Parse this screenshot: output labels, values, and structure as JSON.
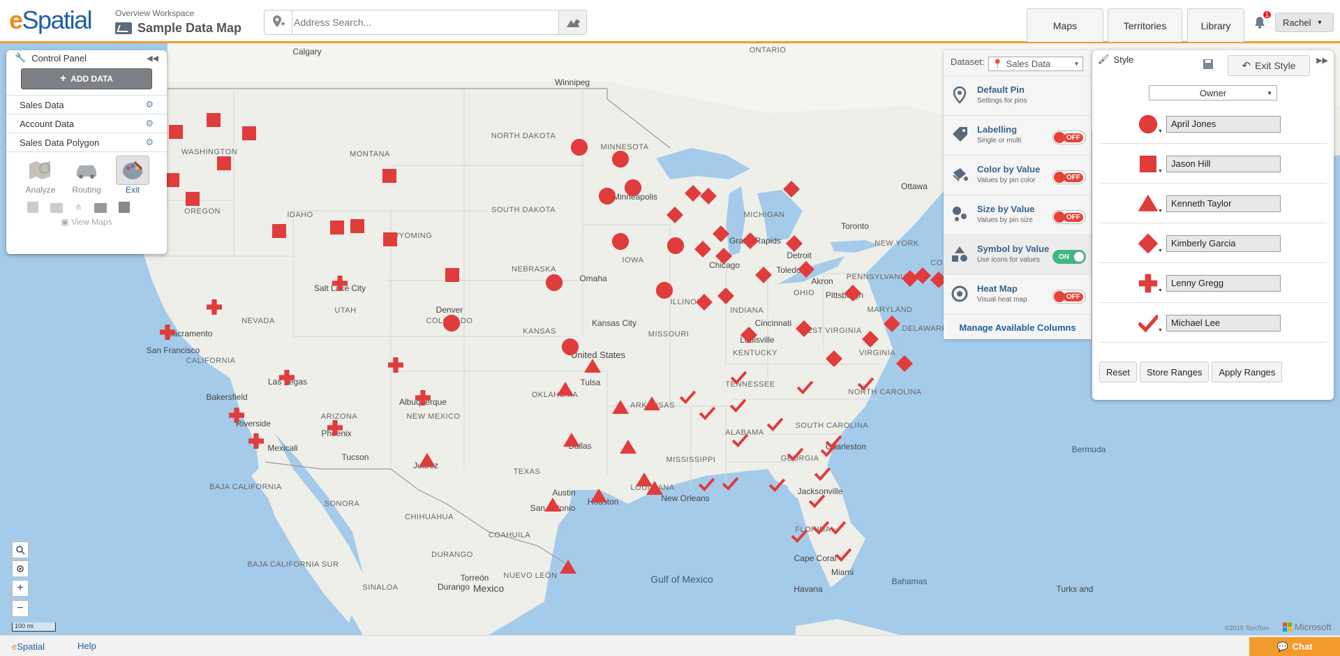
{
  "app": {
    "logo_e": "e",
    "logo_rest": "Spatial"
  },
  "workspace": {
    "label": "Overview Workspace",
    "title": "Sample Data Map"
  },
  "search": {
    "placeholder": "Address Search..."
  },
  "nav": {
    "maps": "Maps",
    "territories": "Territories",
    "library": "Library",
    "notifications": "1",
    "user": "Rachel"
  },
  "control_panel": {
    "title": "Control Panel",
    "add_data": "ADD DATA",
    "layers": [
      "Sales Data",
      "Account Data",
      "Sales Data Polygon"
    ],
    "tools": {
      "analyze": "Analyze",
      "routing": "Routing",
      "exit": "Exit"
    },
    "view_maps": "View Maps"
  },
  "dataset_panel": {
    "label": "Dataset:",
    "selected": "Sales Data",
    "options": [
      {
        "title": "Default Pin",
        "sub": "Settings for pins",
        "toggle": null
      },
      {
        "title": "Labelling",
        "sub": "Single or multi",
        "toggle": "OFF"
      },
      {
        "title": "Color by Value",
        "sub": "Values by pin color",
        "toggle": "OFF"
      },
      {
        "title": "Size by Value",
        "sub": "Values by pin size",
        "toggle": "OFF"
      },
      {
        "title": "Symbol by Value",
        "sub": "Use icons for values",
        "toggle": "ON"
      },
      {
        "title": "Heat Map",
        "sub": "Visual heat map",
        "toggle": "OFF"
      }
    ],
    "manage": "Manage Available Columns"
  },
  "style_panel": {
    "title": "Style",
    "exit": "Exit Style",
    "field": "Owner",
    "owners": [
      {
        "name": "April Jones",
        "symbol": "circle"
      },
      {
        "name": "Jason Hill",
        "symbol": "square"
      },
      {
        "name": "Kenneth Taylor",
        "symbol": "triangle"
      },
      {
        "name": "Kimberly Garcia",
        "symbol": "diamond"
      },
      {
        "name": "Lenny Gregg",
        "symbol": "cross"
      },
      {
        "name": "Michael Lee",
        "symbol": "check"
      }
    ],
    "buttons": {
      "reset": "Reset",
      "store": "Store Ranges",
      "apply": "Apply Ranges"
    },
    "symbol_color": "#e03c3c"
  },
  "map": {
    "places": [
      "Calgary",
      "ONTARIO",
      "Winnipeg",
      "WASHINGTON",
      "MONTANA",
      "NORTH DAKOTA",
      "MINNESOTA",
      "SOUTH DAKOTA",
      "IDAHO",
      "OREGON",
      "WYOMING",
      "Minneapolis",
      "MICHIGAN",
      "Ottawa",
      "Toronto",
      "Grand Rapids",
      "NEW YORK",
      "Detroit",
      "Toledo",
      "Akron",
      "PENNSYLVANIA",
      "Pittsburgh",
      "OHIO",
      "Chicago",
      "IOWA",
      "NEBRASKA",
      "Omaha",
      "Salt Lake City",
      "UTAH",
      "NEVADA",
      "Denver",
      "COLORADO",
      "KANSAS",
      "Kansas City",
      "MISSOURI",
      "ILLINOIS",
      "INDIANA",
      "Cincinnati",
      "WEST VIRGINIA",
      "MARYLAND",
      "DELAWARE",
      "VIRGINIA",
      "Louisville",
      "KENTUCKY",
      "Sacramento",
      "San Francisco",
      "CALIFORNIA",
      "United States",
      "Las Vegas",
      "Tulsa",
      "OKLAHOMA",
      "ARKANSAS",
      "TENNESSEE",
      "NORTH CAROLINA",
      "Bakersfield",
      "ARIZONA",
      "Albuquerque",
      "NEW MEXICO",
      "Riverside",
      "Phoenix",
      "Mexicali",
      "Tucson",
      "Juarez",
      "Dallas",
      "TEXAS",
      "MISSISSIPPI",
      "ALABAMA",
      "SOUTH CAROLINA",
      "GEORGIA",
      "Charleston",
      "LOUISIANA",
      "Austin",
      "Houston",
      "New Orleans",
      "San Antonio",
      "Jacksonville",
      "BAJA CALIFORNIA",
      "SONORA",
      "CHIHUAHUA",
      "Bermuda",
      "FLORIDA",
      "Cape Coral",
      "Miami",
      "Bahamas",
      "DURANGO",
      "Gulf of Mexico",
      "COAHUILA",
      "BAJA CALIFORNIA SUR",
      "Torreón",
      "NUEVO LEÓN",
      "SINALOA",
      "Durango",
      "Mexico",
      "Havana",
      "Turks and",
      "New",
      "CO"
    ],
    "scale": "100 mi",
    "copyright": "©2019 TomTom",
    "provider": "Microsoft"
  },
  "footer": {
    "brand": "eSpatial",
    "help": "Help",
    "chat": "Chat"
  }
}
